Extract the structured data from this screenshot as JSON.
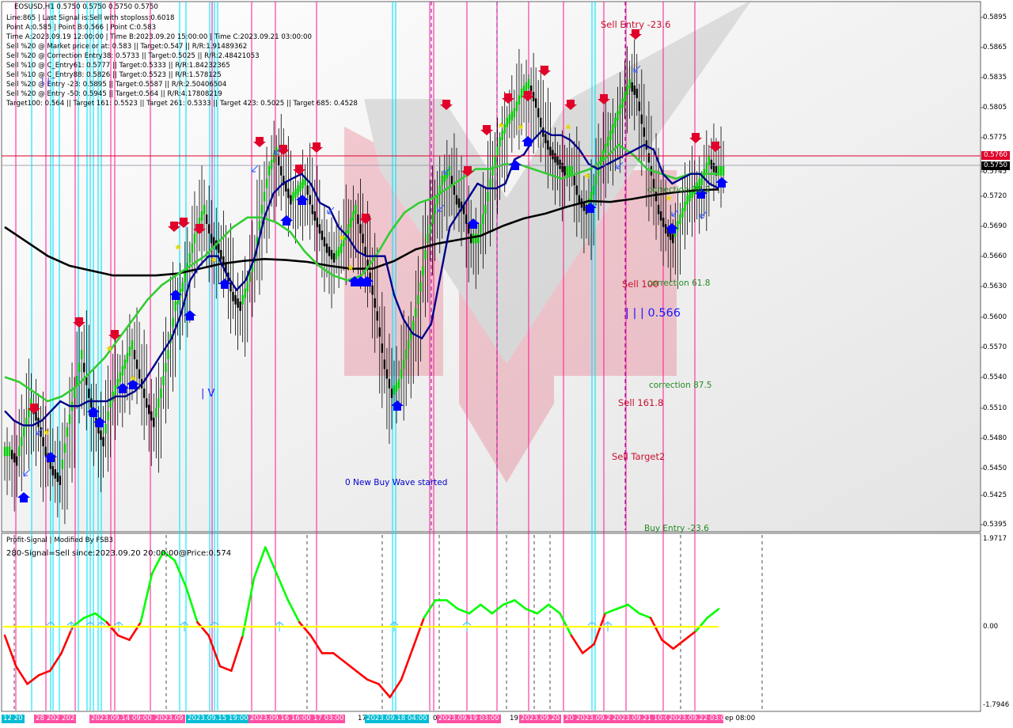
{
  "header": {
    "symbol_line": "EOSUSD,H1  0.5750 0.5750 0.5750 0.5750",
    "lines": [
      "Line:865 | Last Signal is:Sell with stoploss:0.6018",
      "Point A:0.585 | Point B:0.566 | Point C:0.583",
      "Time A:2023.09.19 12:00:00 | Time B:2023.09.20 15:00:00 | Time C:2023.09.21 03:00:00",
      "Sell %20 @ Market price or at: 0.583 || Target:0.547 || R/R:1.91489362",
      "Sell %20 @ Correction Entry38: 0.5733 || Target:0.5025 || R/R:2.48421053",
      "Sell %10 @ C_Entry61: 0.5777 || Target:0.5333 || R/R:1.84232365",
      "Sell %10 @ C_Entry88: 0.5826 || Target:0.5523 || R/R:1.578125",
      "Sell %20 @ Entry -23: 0.5895 || Target:0.5587 || R/R:2.50406504",
      "Sell %20 @ Entry -50: 0.5945 || Target:0.564 || R/R:4.17808219",
      "Target100: 0.564 || Target 161: 0.5523 || Target 261: 0.5333 || Target 423: 0.5025 || Target 685: 0.4528"
    ]
  },
  "annotations": {
    "sell_entry": "Sell Entry -23.6",
    "correction_38": "correction 38.2",
    "sell_100": "Sell 100",
    "correction_61": "correction 61.8",
    "level_566": "| | | 0.566",
    "correction_87": "correction 87.5",
    "sell_161": "Sell 161.8",
    "sell_target2": "Sell Target2",
    "buy_entry": "Buy Entry -23.6",
    "new_buy_wave": "0 New Buy Wave started",
    "wave_iv": "| V",
    "wave_i": "| |"
  },
  "prices": {
    "current": "0.5750",
    "stoploss_line": "0.5760"
  },
  "colors": {
    "sell": "#e0002a",
    "buy": "#0000ff",
    "ma_fast": "#00008b",
    "ma_mid": "#32cd32",
    "ma_slow": "#000000",
    "cyan_line": "#00e5ff",
    "magenta_line": "#ff1493",
    "osc_up": "#00ff00",
    "osc_down": "#ff0000",
    "zero_line": "#ffff00"
  },
  "y_axis_ticks": [
    "0.5895",
    "0.5865",
    "0.5835",
    "0.5805",
    "0.5775",
    "0.5745",
    "0.5720",
    "0.5690",
    "0.5660",
    "0.5630",
    "0.5600",
    "0.5570",
    "0.5540",
    "0.5510",
    "0.5480",
    "0.5450",
    "0.5425",
    "0.5395"
  ],
  "indicator": {
    "title": "Profit-Signal | Modified By FSB3",
    "signal_text": "280-Signal=Sell since:2023.09.20 20:00:00@Price:0.574",
    "ticks": [
      "1.9717",
      "0.00",
      "-1.7946"
    ]
  },
  "x_axis_labels": [
    "12 20",
    "28",
    "202",
    "202",
    "2023.09.14 09:00",
    "2023.09",
    "2023.09.15 19:00",
    "2023.09.16 16:00",
    "17 03:00",
    "17",
    "2023.09.18 04:00",
    "0",
    "2023.09.19 03:00",
    "19",
    "2023.09.20",
    "20",
    "2023.09.2",
    "2023.09.21 10:0",
    "2023.09.22 03:00",
    "ep 08:00"
  ],
  "chart_data": {
    "type": "candlestick",
    "symbol": "EOSUSD",
    "timeframe": "H1",
    "ylim": [
      0.5385,
      0.5915
    ],
    "close_series": [
      0.546,
      0.545,
      0.548,
      0.551,
      0.549,
      0.546,
      0.544,
      0.543,
      0.548,
      0.552,
      0.556,
      0.552,
      0.549,
      0.547,
      0.551,
      0.553,
      0.555,
      0.557,
      0.554,
      0.551,
      0.549,
      0.552,
      0.556,
      0.561,
      0.563,
      0.566,
      0.569,
      0.571,
      0.568,
      0.567,
      0.565,
      0.562,
      0.561,
      0.563,
      0.566,
      0.571,
      0.575,
      0.577,
      0.574,
      0.572,
      0.573,
      0.574,
      0.571,
      0.569,
      0.567,
      0.566,
      0.567,
      0.569,
      0.571,
      0.568,
      0.564,
      0.56,
      0.555,
      0.552,
      0.553,
      0.556,
      0.559,
      0.563,
      0.568,
      0.571,
      0.574,
      0.575,
      0.572,
      0.571,
      0.568,
      0.568,
      0.571,
      0.575,
      0.578,
      0.58,
      0.581,
      0.583,
      0.584,
      0.582,
      0.579,
      0.577,
      0.576,
      0.575,
      0.575,
      0.572,
      0.571,
      0.573,
      0.576,
      0.578,
      0.58,
      0.582,
      0.584,
      0.583,
      0.579,
      0.575,
      0.571,
      0.569,
      0.568,
      0.57,
      0.572,
      0.573,
      0.574,
      0.576,
      0.575,
      0.575
    ],
    "sma_fast_series": [
      0.5505,
      0.5495,
      0.549,
      0.549,
      0.5495,
      0.5505,
      0.5515,
      0.551,
      0.551,
      0.5515,
      0.5515,
      0.5515,
      0.552,
      0.552,
      0.5525,
      0.5535,
      0.555,
      0.5565,
      0.558,
      0.5605,
      0.564,
      0.5655,
      0.5665,
      0.5665,
      0.5645,
      0.563,
      0.564,
      0.5665,
      0.5705,
      0.573,
      0.574,
      0.5745,
      0.575,
      0.574,
      0.572,
      0.5715,
      0.5695,
      0.5685,
      0.567,
      0.5665,
      0.5665,
      0.5665,
      0.5625,
      0.56,
      0.5585,
      0.558,
      0.5595,
      0.5645,
      0.5695,
      0.571,
      0.5725,
      0.574,
      0.5735,
      0.5735,
      0.574,
      0.5765,
      0.577,
      0.5785,
      0.5795,
      0.579,
      0.579,
      0.5785,
      0.5775,
      0.576,
      0.5755,
      0.576,
      0.5765,
      0.577,
      0.5775,
      0.578,
      0.5775,
      0.575,
      0.574,
      0.5745,
      0.575,
      0.575,
      0.574,
      0.5735
    ],
    "sma_mid_series": [
      0.554,
      0.5535,
      0.5525,
      0.5515,
      0.552,
      0.553,
      0.5545,
      0.556,
      0.558,
      0.56,
      0.562,
      0.5635,
      0.5645,
      0.5655,
      0.5665,
      0.568,
      0.5695,
      0.5705,
      0.5705,
      0.57,
      0.569,
      0.567,
      0.5655,
      0.5645,
      0.564,
      0.5645,
      0.5665,
      0.569,
      0.571,
      0.572,
      0.5725,
      0.5735,
      0.5745,
      0.5755,
      0.5755,
      0.576,
      0.576,
      0.5755,
      0.575,
      0.5745,
      0.575,
      0.5755,
      0.5765,
      0.578,
      0.577,
      0.5755,
      0.575,
      0.5745,
      0.575,
      0.575,
      0.575
    ],
    "sma_slow_series": [
      0.5695,
      0.568,
      0.5665,
      0.5655,
      0.565,
      0.5645,
      0.5645,
      0.5645,
      0.5647,
      0.5652,
      0.5657,
      0.566,
      0.5662,
      0.5661,
      0.5659,
      0.5655,
      0.5652,
      0.5652,
      0.566,
      0.5672,
      0.5678,
      0.5682,
      0.5686,
      0.5696,
      0.5704,
      0.5709,
      0.5716,
      0.5722,
      0.5721,
      0.5724,
      0.5728,
      0.5731,
      0.5733,
      0.5734
    ],
    "levels": [
      {
        "name": "stoploss",
        "value": 0.576
      },
      {
        "name": "current",
        "value": 0.575
      }
    ],
    "oscillator": {
      "ylim": [
        -1.7946,
        1.9717
      ],
      "values": [
        -0.2,
        -0.9,
        -1.3,
        -1.1,
        -1.0,
        -0.6,
        0.0,
        0.2,
        0.3,
        0.1,
        -0.2,
        -0.3,
        0.1,
        1.2,
        1.7,
        1.5,
        0.9,
        0.1,
        -0.2,
        -0.9,
        -1.0,
        -0.2,
        1.1,
        1.8,
        1.2,
        0.6,
        0.1,
        -0.2,
        -0.6,
        -0.6,
        -0.8,
        -1.0,
        -1.2,
        -1.3,
        -1.6,
        -1.2,
        -0.5,
        0.2,
        0.6,
        0.6,
        0.4,
        0.3,
        0.5,
        0.3,
        0.5,
        0.6,
        0.4,
        0.3,
        0.5,
        0.3,
        -0.2,
        -0.6,
        -0.4,
        0.3,
        0.4,
        0.5,
        0.3,
        0.2,
        -0.3,
        -0.5,
        -0.3,
        -0.1,
        0.2,
        0.4
      ],
      "zero": 0.0
    }
  }
}
